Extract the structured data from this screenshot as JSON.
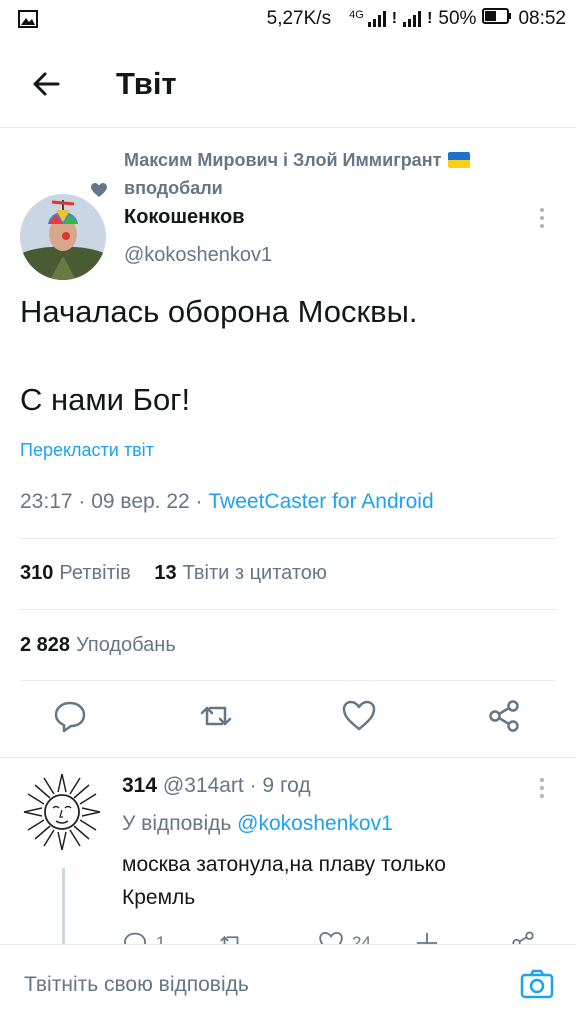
{
  "status_bar": {
    "speed": "5,27K/s",
    "network": "4G",
    "battery": "50%",
    "time": "08:52"
  },
  "header": {
    "title": "Твіт"
  },
  "tweet": {
    "liked_by": "Максим Мирович і Злой Иммигрант",
    "liked_suffix": "вподобали",
    "author_name": "Кокошенков",
    "author_handle": "@kokoshenkov1",
    "text_line1": "Началась оборона Москвы.",
    "text_line2": "С нами Бог!",
    "translate_label": "Перекласти твіт",
    "timestamp": "23:17 · 09 вер. 22 · ",
    "source": "TweetCaster for Android",
    "retweets_count": "310",
    "retweets_label": "Ретвітів",
    "quotes_count": "13",
    "quotes_label": "Твіти з цитатою",
    "likes_count": "2 828",
    "likes_label": "Уподобань"
  },
  "reply": {
    "author_name": "314",
    "author_handle": "@314art",
    "time": "· 9 год",
    "reply_to_label": "У відповідь",
    "reply_to_handle": "@kokoshenkov1",
    "text_line1": "москва затонула,на плаву только",
    "text_line2": "Кремль",
    "reply_count": "1",
    "like_count": "24"
  },
  "composer": {
    "placeholder": "Твітніть свою відповідь"
  },
  "colors": {
    "accent": "#1da1f2",
    "muted": "#657786",
    "text": "#14171a",
    "divider": "#e6ecf0"
  }
}
